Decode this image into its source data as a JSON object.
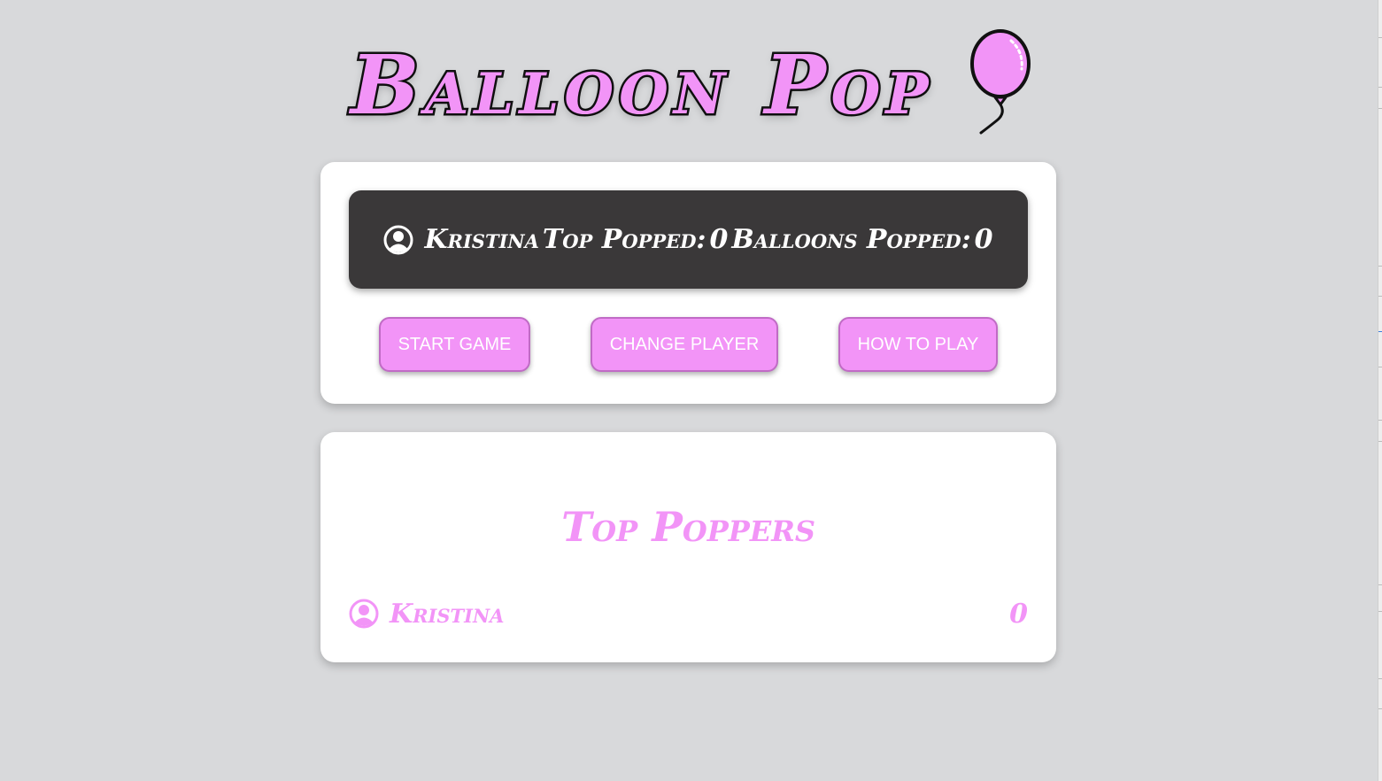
{
  "app": {
    "title": "Balloon Pop"
  },
  "colors": {
    "accent": "#f294f7",
    "accent_border": "#c06bc5",
    "stats_bg": "#3a3839",
    "page_bg": "#d8d9db"
  },
  "stats": {
    "player_name": "Kristina",
    "top_popped_label": "Top Popped:",
    "top_popped_value": "0",
    "balloons_popped_label": "Balloons Popped:",
    "balloons_popped_value": "0",
    "icon": "user-circle-icon"
  },
  "buttons": {
    "start_label": "START GAME",
    "change_player_label": "CHANGE PLAYER",
    "how_to_play_label": "HOW TO PLAY"
  },
  "leaderboard": {
    "title": "Top Poppers",
    "entries": [
      {
        "name": "Kristina",
        "score": "0",
        "icon": "user-circle-icon"
      }
    ]
  }
}
